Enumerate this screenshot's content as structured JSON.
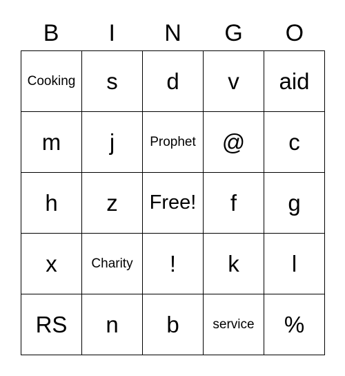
{
  "header": [
    "B",
    "I",
    "N",
    "G",
    "O"
  ],
  "cells": [
    [
      "Cooking",
      "s",
      "d",
      "v",
      "aid"
    ],
    [
      "m",
      "j",
      "Prophet",
      "@",
      "c"
    ],
    [
      "h",
      "z",
      "Free!",
      "f",
      "g"
    ],
    [
      "x",
      "Charity",
      "!",
      "k",
      "l"
    ],
    [
      "RS",
      "n",
      "b",
      "service",
      "%"
    ]
  ]
}
